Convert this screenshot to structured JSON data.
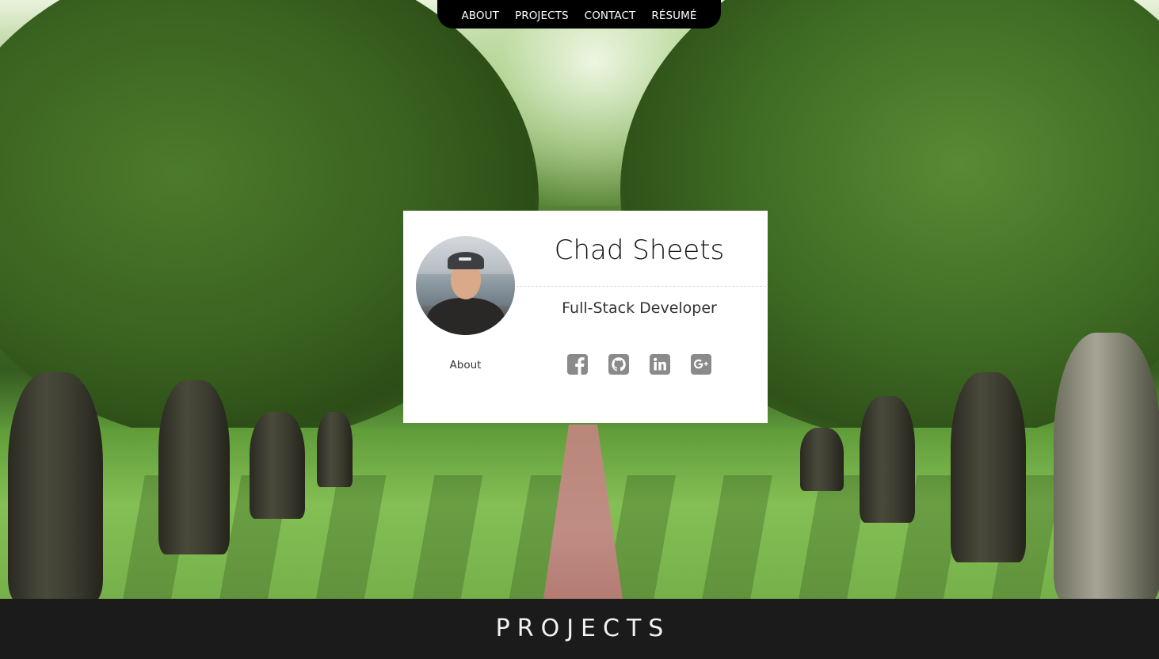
{
  "nav": {
    "items": [
      {
        "label": "ABOUT"
      },
      {
        "label": "PROJECTS"
      },
      {
        "label": "CONTACT"
      },
      {
        "label": "RÉSUMÉ"
      }
    ],
    "bg_color": "#000000",
    "text_color": "#ffffff"
  },
  "profile": {
    "name": "Chad Sheets",
    "title": "Full-Stack Developer",
    "about_link": "About",
    "avatar_icon": "profile-photo",
    "socials": [
      {
        "icon": "facebook-icon"
      },
      {
        "icon": "github-icon"
      },
      {
        "icon": "linkedin-icon"
      },
      {
        "icon": "google-plus-icon"
      }
    ],
    "social_icon_color": "#8a8a8a"
  },
  "projects_section": {
    "heading": "PROJECTS",
    "bg_color": "#1b1b1b"
  }
}
